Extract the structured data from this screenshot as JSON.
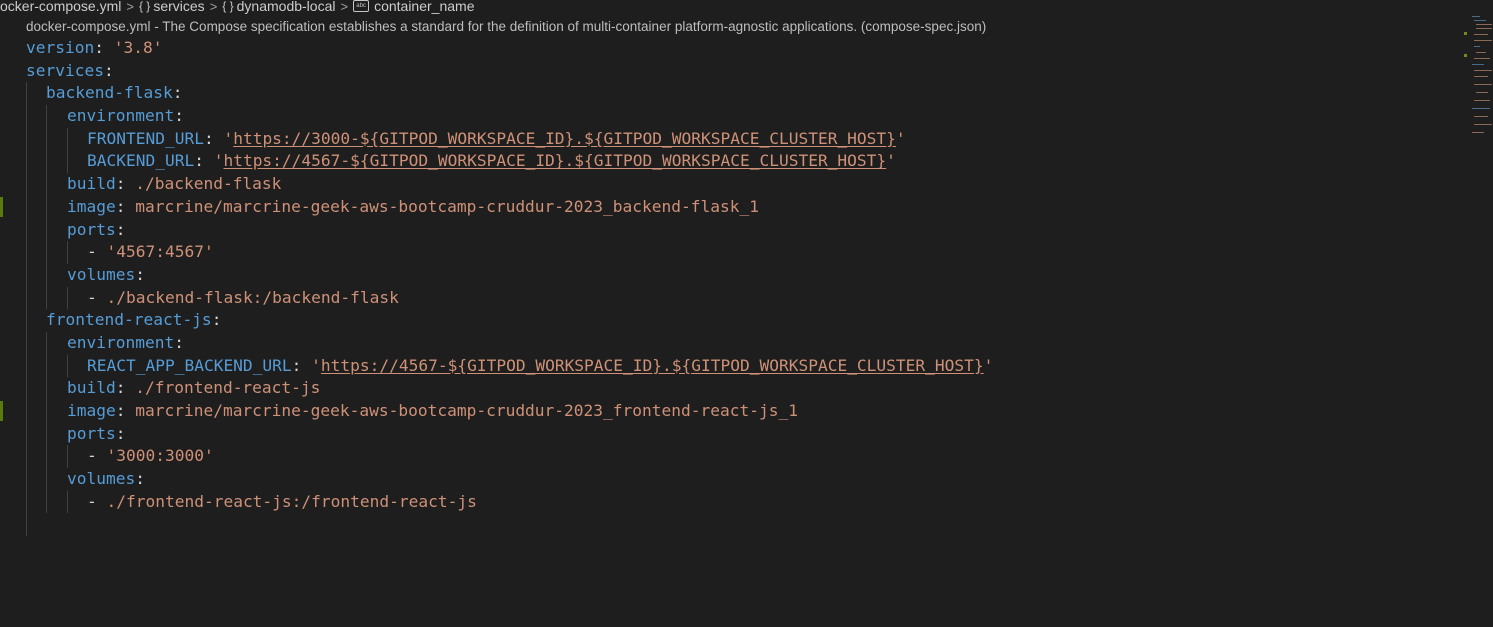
{
  "breadcrumb": {
    "file": "ocker-compose.yml",
    "services": "services",
    "dynamodb": "dynamodb-local",
    "container": "container_name",
    "object_icon": "{ }",
    "separator": ">"
  },
  "schema_hint": "docker-compose.yml - The Compose specification establishes a standard for the definition of multi-container platform-agnostic applications. (compose-spec.json)",
  "yaml": {
    "version_key": "version",
    "version_value": "'3.8'",
    "services_key": "services",
    "backend": {
      "name": "backend-flask",
      "environment_key": "environment",
      "frontend_url_key": "FRONTEND_URL",
      "frontend_url_value": "https://3000-${GITPOD_WORKSPACE_ID}.${GITPOD_WORKSPACE_CLUSTER_HOST}",
      "backend_url_key": "BACKEND_URL",
      "backend_url_value": "https://4567-${GITPOD_WORKSPACE_ID}.${GITPOD_WORKSPACE_CLUSTER_HOST}",
      "build_key": "build",
      "build_value": "./backend-flask",
      "image_key": "image",
      "image_value": "marcrine/marcrine-geek-aws-bootcamp-cruddur-2023_backend-flask_1",
      "ports_key": "ports",
      "port_value": "'4567:4567'",
      "volumes_key": "volumes",
      "volume_value": "./backend-flask:/backend-flask"
    },
    "frontend": {
      "name": "frontend-react-js",
      "environment_key": "environment",
      "react_url_key": "REACT_APP_BACKEND_URL",
      "react_url_value": "https://4567-${GITPOD_WORKSPACE_ID}.${GITPOD_WORKSPACE_CLUSTER_HOST}",
      "build_key": "build",
      "build_value": "./frontend-react-js",
      "image_key": "image",
      "image_value": "marcrine/marcrine-geek-aws-bootcamp-cruddur-2023_frontend-react-js_1",
      "ports_key": "ports",
      "port_value": "'3000:3000'",
      "volumes_key": "volumes",
      "volume_value": "./frontend-react-js:/frontend-react-js"
    },
    "colon": ":",
    "dash": "- ",
    "quote": "'"
  },
  "colors": {
    "background": "#1e1e1e",
    "key": "#569cd6",
    "string": "#ce9178",
    "plain": "#d4d4d4",
    "modified_gutter": "#587c0c"
  }
}
